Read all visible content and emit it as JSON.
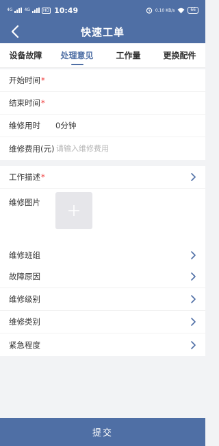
{
  "status_bar": {
    "sig1": "4G",
    "sig2": "4G",
    "hd": "HD",
    "time": "10:49",
    "net_speed": "0.10 KB/s",
    "battery": "66"
  },
  "header": {
    "title": "快速工单"
  },
  "tabs": [
    {
      "label": "设备故障"
    },
    {
      "label": "处理意见"
    },
    {
      "label": "工作量"
    },
    {
      "label": "更换配件"
    }
  ],
  "active_tab": 1,
  "form": {
    "start_time_label": "开始时间",
    "end_time_label": "结束时间",
    "required_mark": "*",
    "duration_label": "维修用时",
    "duration_value": "0分钟",
    "cost_label": "维修费用(元)",
    "cost_placeholder": "请输入维修费用",
    "work_desc_label": "工作描述",
    "photos_label": "维修图片",
    "team_label": "维修班组",
    "fault_cause_label": "故障原因",
    "repair_level_label": "维修级别",
    "repair_type_label": "维修类别",
    "urgency_label": "紧急程度"
  },
  "submit_label": "提交",
  "colors": {
    "primary": "#4f6fa5",
    "required": "#e33333",
    "background": "#f2f3f5"
  }
}
